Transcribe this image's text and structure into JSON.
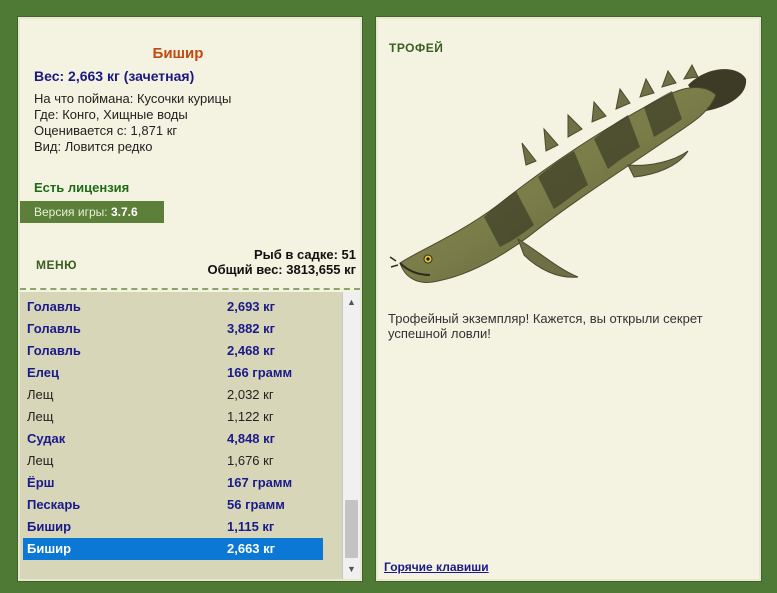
{
  "fish": {
    "title": "Бишир",
    "weight_line": "Вес: 2,663 кг (зачетная)",
    "caught_on": "На что поймана: Кусочки курицы",
    "location": "Где: Конго, Хищные воды",
    "valued_from": "Оценивается с: 1,871 кг",
    "species": "Вид: Ловится редко"
  },
  "license": "Есть лицензия",
  "version": {
    "label": "Версия игры:",
    "value": "3.7.6"
  },
  "menu_label": "МЕНЮ",
  "net": {
    "count": "Рыб в садке: 51",
    "total": "Общий вес: 3813,655 кг"
  },
  "catch_list": [
    {
      "name": "Голавль",
      "weight": "2,693 кг",
      "style": "bold"
    },
    {
      "name": "Голавль",
      "weight": "3,882 кг",
      "style": "bold"
    },
    {
      "name": "Голавль",
      "weight": "2,468 кг",
      "style": "bold"
    },
    {
      "name": "Елец",
      "weight": "166 грамм",
      "style": "bold"
    },
    {
      "name": "Лещ",
      "weight": "2,032 кг",
      "style": "plain"
    },
    {
      "name": "Лещ",
      "weight": "1,122 кг",
      "style": "plain"
    },
    {
      "name": "Судак",
      "weight": "4,848 кг",
      "style": "bold"
    },
    {
      "name": "Лещ",
      "weight": "1,676 кг",
      "style": "plain"
    },
    {
      "name": "Ёрш",
      "weight": "167 грамм",
      "style": "bold"
    },
    {
      "name": "Пескарь",
      "weight": "56 грамм",
      "style": "bold"
    },
    {
      "name": "Бишир",
      "weight": "1,115 кг",
      "style": "bold"
    },
    {
      "name": "Бишир",
      "weight": "2,663 кг",
      "style": "selected"
    }
  ],
  "trophy": {
    "label": "ТРОФЕЙ",
    "text": "Трофейный экземпляр! Кажется, вы открыли секрет успешной ловли!"
  },
  "hotkeys_label": "Горячие клавиши"
}
